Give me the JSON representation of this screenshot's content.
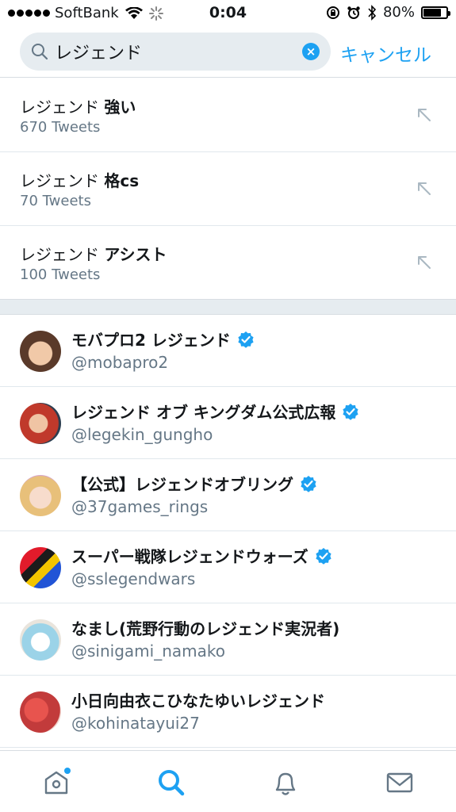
{
  "status_bar": {
    "carrier": "SoftBank",
    "time": "0:04",
    "battery": "80%",
    "battery_level": 0.8
  },
  "search": {
    "value": "レジェンド",
    "cancel_label": "キャンセル"
  },
  "suggestions": [
    {
      "prefix": "レジェンド",
      "suffix": "強い",
      "count": "670 Tweets"
    },
    {
      "prefix": "レジェンド",
      "suffix": "格cs",
      "count": "70 Tweets"
    },
    {
      "prefix": "レジェンド",
      "suffix": "アシスト",
      "count": "100 Tweets"
    }
  ],
  "users": [
    {
      "name": "モバプロ2 レジェンド",
      "handle": "@mobapro2",
      "verified": true
    },
    {
      "name": "レジェンド オブ キングダム公式広報",
      "handle": "@legekin_gungho",
      "verified": true
    },
    {
      "name": "【公式】レジェンドオブリング",
      "handle": "@37games_rings",
      "verified": true
    },
    {
      "name": "スーパー戦隊レジェンドウォーズ",
      "handle": "@sslegendwars",
      "verified": true
    },
    {
      "name": "なまし(荒野行動のレジェンド実況者)",
      "handle": "@sinigami_namako",
      "verified": false
    },
    {
      "name": "小日向由衣こひなたゆいレジェンド",
      "handle": "@kohinatayui27",
      "verified": false
    }
  ],
  "colors": {
    "accent": "#1da1f2",
    "secondary_text": "#657786",
    "divider": "#e6ecf0"
  },
  "tabs": [
    "home-icon",
    "search-icon",
    "bell-icon",
    "mail-icon"
  ]
}
